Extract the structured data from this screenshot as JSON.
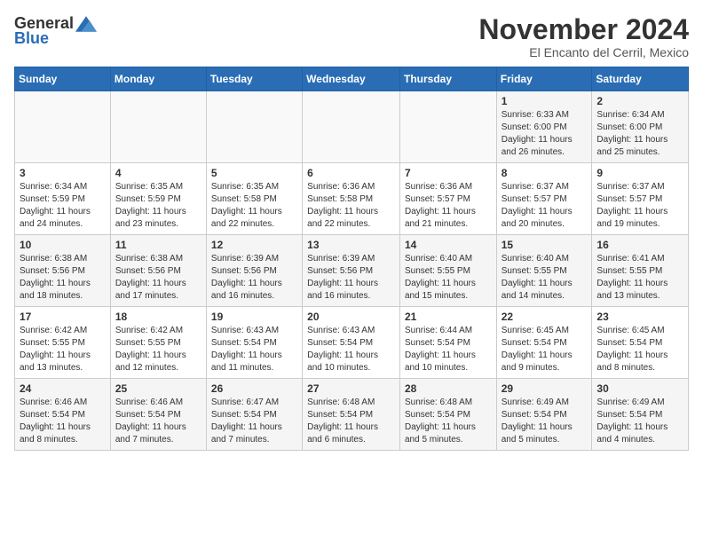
{
  "logo": {
    "general": "General",
    "blue": "Blue"
  },
  "header": {
    "month": "November 2024",
    "location": "El Encanto del Cerril, Mexico"
  },
  "weekdays": [
    "Sunday",
    "Monday",
    "Tuesday",
    "Wednesday",
    "Thursday",
    "Friday",
    "Saturday"
  ],
  "weeks": [
    [
      {
        "day": "",
        "info": ""
      },
      {
        "day": "",
        "info": ""
      },
      {
        "day": "",
        "info": ""
      },
      {
        "day": "",
        "info": ""
      },
      {
        "day": "",
        "info": ""
      },
      {
        "day": "1",
        "info": "Sunrise: 6:33 AM\nSunset: 6:00 PM\nDaylight: 11 hours and 26 minutes."
      },
      {
        "day": "2",
        "info": "Sunrise: 6:34 AM\nSunset: 6:00 PM\nDaylight: 11 hours and 25 minutes."
      }
    ],
    [
      {
        "day": "3",
        "info": "Sunrise: 6:34 AM\nSunset: 5:59 PM\nDaylight: 11 hours and 24 minutes."
      },
      {
        "day": "4",
        "info": "Sunrise: 6:35 AM\nSunset: 5:59 PM\nDaylight: 11 hours and 23 minutes."
      },
      {
        "day": "5",
        "info": "Sunrise: 6:35 AM\nSunset: 5:58 PM\nDaylight: 11 hours and 22 minutes."
      },
      {
        "day": "6",
        "info": "Sunrise: 6:36 AM\nSunset: 5:58 PM\nDaylight: 11 hours and 22 minutes."
      },
      {
        "day": "7",
        "info": "Sunrise: 6:36 AM\nSunset: 5:57 PM\nDaylight: 11 hours and 21 minutes."
      },
      {
        "day": "8",
        "info": "Sunrise: 6:37 AM\nSunset: 5:57 PM\nDaylight: 11 hours and 20 minutes."
      },
      {
        "day": "9",
        "info": "Sunrise: 6:37 AM\nSunset: 5:57 PM\nDaylight: 11 hours and 19 minutes."
      }
    ],
    [
      {
        "day": "10",
        "info": "Sunrise: 6:38 AM\nSunset: 5:56 PM\nDaylight: 11 hours and 18 minutes."
      },
      {
        "day": "11",
        "info": "Sunrise: 6:38 AM\nSunset: 5:56 PM\nDaylight: 11 hours and 17 minutes."
      },
      {
        "day": "12",
        "info": "Sunrise: 6:39 AM\nSunset: 5:56 PM\nDaylight: 11 hours and 16 minutes."
      },
      {
        "day": "13",
        "info": "Sunrise: 6:39 AM\nSunset: 5:56 PM\nDaylight: 11 hours and 16 minutes."
      },
      {
        "day": "14",
        "info": "Sunrise: 6:40 AM\nSunset: 5:55 PM\nDaylight: 11 hours and 15 minutes."
      },
      {
        "day": "15",
        "info": "Sunrise: 6:40 AM\nSunset: 5:55 PM\nDaylight: 11 hours and 14 minutes."
      },
      {
        "day": "16",
        "info": "Sunrise: 6:41 AM\nSunset: 5:55 PM\nDaylight: 11 hours and 13 minutes."
      }
    ],
    [
      {
        "day": "17",
        "info": "Sunrise: 6:42 AM\nSunset: 5:55 PM\nDaylight: 11 hours and 13 minutes."
      },
      {
        "day": "18",
        "info": "Sunrise: 6:42 AM\nSunset: 5:55 PM\nDaylight: 11 hours and 12 minutes."
      },
      {
        "day": "19",
        "info": "Sunrise: 6:43 AM\nSunset: 5:54 PM\nDaylight: 11 hours and 11 minutes."
      },
      {
        "day": "20",
        "info": "Sunrise: 6:43 AM\nSunset: 5:54 PM\nDaylight: 11 hours and 10 minutes."
      },
      {
        "day": "21",
        "info": "Sunrise: 6:44 AM\nSunset: 5:54 PM\nDaylight: 11 hours and 10 minutes."
      },
      {
        "day": "22",
        "info": "Sunrise: 6:45 AM\nSunset: 5:54 PM\nDaylight: 11 hours and 9 minutes."
      },
      {
        "day": "23",
        "info": "Sunrise: 6:45 AM\nSunset: 5:54 PM\nDaylight: 11 hours and 8 minutes."
      }
    ],
    [
      {
        "day": "24",
        "info": "Sunrise: 6:46 AM\nSunset: 5:54 PM\nDaylight: 11 hours and 8 minutes."
      },
      {
        "day": "25",
        "info": "Sunrise: 6:46 AM\nSunset: 5:54 PM\nDaylight: 11 hours and 7 minutes."
      },
      {
        "day": "26",
        "info": "Sunrise: 6:47 AM\nSunset: 5:54 PM\nDaylight: 11 hours and 7 minutes."
      },
      {
        "day": "27",
        "info": "Sunrise: 6:48 AM\nSunset: 5:54 PM\nDaylight: 11 hours and 6 minutes."
      },
      {
        "day": "28",
        "info": "Sunrise: 6:48 AM\nSunset: 5:54 PM\nDaylight: 11 hours and 5 minutes."
      },
      {
        "day": "29",
        "info": "Sunrise: 6:49 AM\nSunset: 5:54 PM\nDaylight: 11 hours and 5 minutes."
      },
      {
        "day": "30",
        "info": "Sunrise: 6:49 AM\nSunset: 5:54 PM\nDaylight: 11 hours and 4 minutes."
      }
    ]
  ]
}
